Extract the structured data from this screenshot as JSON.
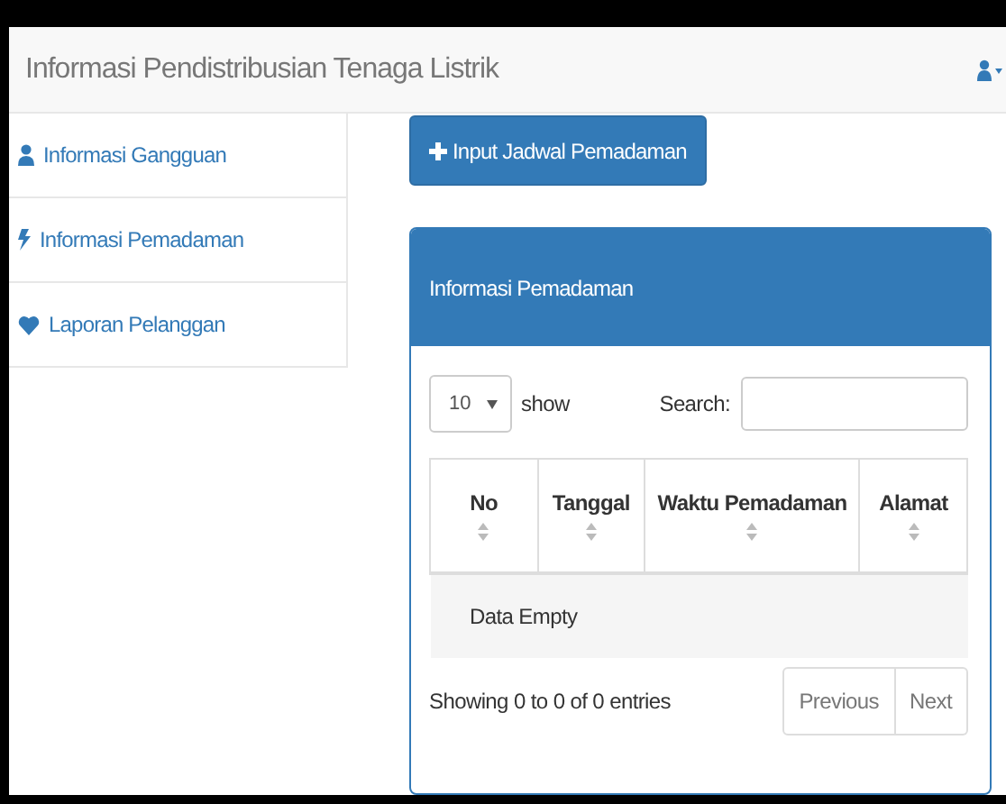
{
  "navbar": {
    "title": "Informasi Pendistribusian Tenaga Listrik"
  },
  "sidebar": {
    "items": [
      {
        "label": "Informasi Gangguan"
      },
      {
        "label": "Informasi Pemadaman"
      },
      {
        "label": "Laporan Pelanggan"
      }
    ]
  },
  "add_button": {
    "label": "Input Jadwal Pemadaman"
  },
  "panel": {
    "title": "Informasi Pemadaman",
    "page_size": {
      "value": "10",
      "label": "show"
    },
    "search": {
      "label": "Search:"
    },
    "table": {
      "columns": [
        "No",
        "Tanggal",
        "Waktu Pemadaman",
        "Alamat"
      ],
      "empty": "Data Empty"
    },
    "info": "Showing 0 to 0 of 0 entries",
    "pagination": [
      "Previous",
      "Next"
    ]
  }
}
